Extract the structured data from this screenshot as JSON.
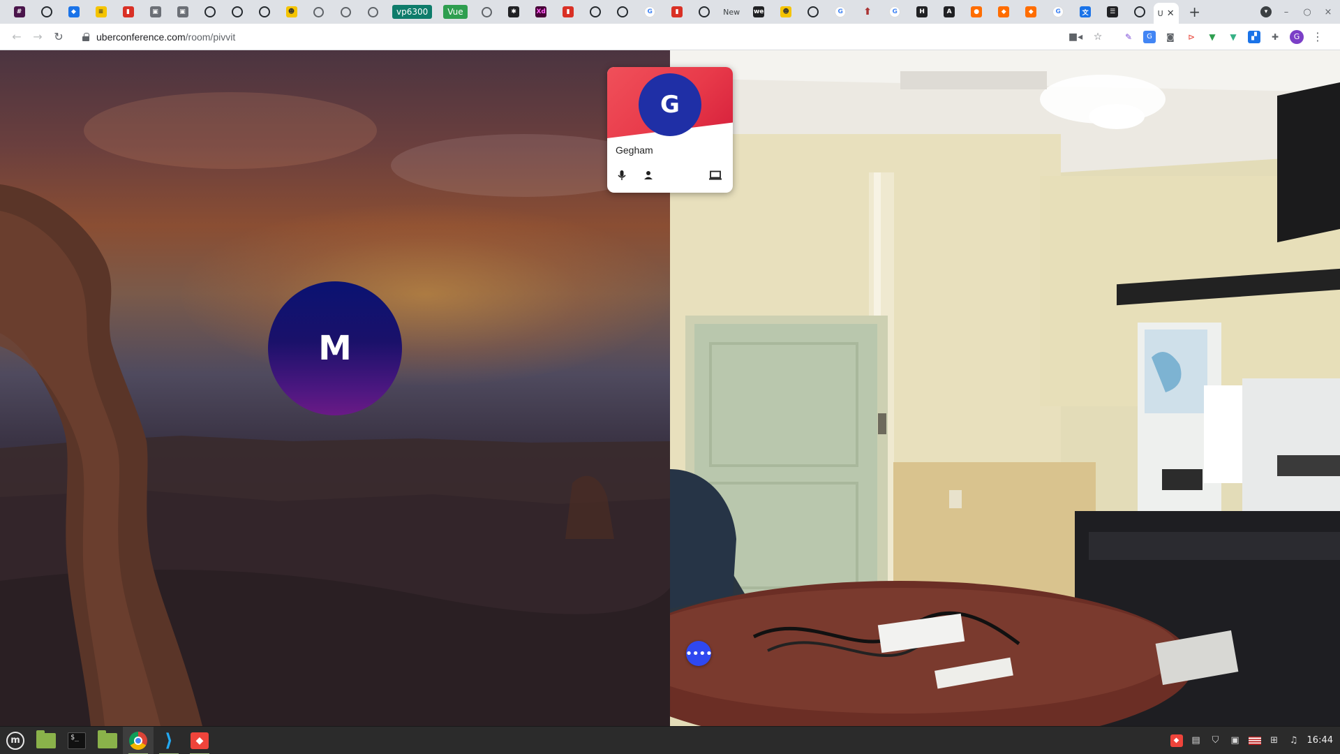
{
  "browser": {
    "tabs": [
      {
        "icon": "slack-icon",
        "kind": "slack",
        "glyph": "#"
      },
      {
        "icon": "github-icon",
        "kind": "github",
        "glyph": ""
      },
      {
        "icon": "jira-icon",
        "kind": "blue",
        "glyph": "◆"
      },
      {
        "icon": "stack-icon",
        "kind": "yellow",
        "glyph": "≡"
      },
      {
        "icon": "red-square-icon",
        "kind": "red",
        "glyph": "▮"
      },
      {
        "icon": "app-icon",
        "kind": "gray",
        "glyph": "▣"
      },
      {
        "icon": "app-icon",
        "kind": "gray",
        "glyph": "▣"
      },
      {
        "icon": "github-icon",
        "kind": "github",
        "glyph": ""
      },
      {
        "icon": "github-icon",
        "kind": "github",
        "glyph": ""
      },
      {
        "icon": "github-icon",
        "kind": "github",
        "glyph": ""
      },
      {
        "icon": "smiley-icon",
        "kind": "yellow",
        "glyph": "☻"
      },
      {
        "icon": "at-icon",
        "kind": "globe",
        "glyph": ""
      },
      {
        "icon": "globe-icon",
        "kind": "globe",
        "glyph": ""
      },
      {
        "icon": "globe-icon",
        "kind": "globe",
        "glyph": ""
      }
    ],
    "pill_tabs": [
      {
        "label": "vp6300",
        "color": "#0e7c6b"
      },
      {
        "label": "Vue",
        "color": "#2e9e4f"
      }
    ],
    "tabs_after": [
      {
        "icon": "globe-icon",
        "kind": "globe",
        "glyph": ""
      },
      {
        "icon": "puzzle-icon",
        "kind": "dark",
        "glyph": "✱"
      },
      {
        "icon": "adobe-xd-icon",
        "kind": "purple",
        "glyph": "Xd"
      },
      {
        "icon": "red-square-icon",
        "kind": "red",
        "glyph": "▮"
      },
      {
        "icon": "github-icon",
        "kind": "github",
        "glyph": ""
      },
      {
        "icon": "github-icon",
        "kind": "github",
        "glyph": ""
      },
      {
        "icon": "google-icon",
        "kind": "gg",
        "glyph": "G"
      },
      {
        "icon": "red-square-icon",
        "kind": "red",
        "glyph": "▮"
      },
      {
        "icon": "github-icon",
        "kind": "github",
        "glyph": ""
      }
    ],
    "text_tab": "New",
    "tabs_tail": [
      {
        "icon": "we-icon",
        "kind": "dark",
        "glyph": "we"
      },
      {
        "icon": "smiley-icon",
        "kind": "yellow",
        "glyph": "☻"
      },
      {
        "icon": "github-icon",
        "kind": "github",
        "glyph": ""
      },
      {
        "icon": "google-icon",
        "kind": "gg",
        "glyph": "G"
      },
      {
        "icon": "arrow-icon",
        "kind": "arrow",
        "glyph": "⬆"
      },
      {
        "icon": "google-icon",
        "kind": "gg",
        "glyph": "G"
      },
      {
        "icon": "html-icon",
        "kind": "dark",
        "glyph": "H"
      },
      {
        "icon": "figure-icon",
        "kind": "dark",
        "glyph": "A"
      },
      {
        "icon": "reddit-icon",
        "kind": "orange",
        "glyph": "●"
      },
      {
        "icon": "puzzle-piece-icon",
        "kind": "orange",
        "glyph": "◆"
      },
      {
        "icon": "puzzle-piece-icon",
        "kind": "orange",
        "glyph": "◆"
      },
      {
        "icon": "google-icon",
        "kind": "gg",
        "glyph": "G"
      },
      {
        "icon": "translate-icon",
        "kind": "blue",
        "glyph": "文"
      },
      {
        "icon": "doc-icon",
        "kind": "dark",
        "glyph": "☰"
      },
      {
        "icon": "github-icon",
        "kind": "github",
        "glyph": ""
      }
    ],
    "active_tab_label": "U",
    "active_tab_close": "✕",
    "new_tab": "+",
    "url_host": "uberconference.com",
    "url_path": "/room/pivvit",
    "profile_initial": "G"
  },
  "conference": {
    "left_participant_initial": "M",
    "card": {
      "avatar_initial": "G",
      "name": "Gegham"
    },
    "more_button": "••••"
  },
  "taskbar": {
    "menu_glyph": "m",
    "terminal_text": "$_",
    "vscode_glyph": "⟩",
    "clock": "16:44"
  },
  "colors": {
    "card_banner": "#e83a4a",
    "card_avatar": "#1f2fa6",
    "more_button": "#2f48f0",
    "avatar_m_top": "#0a1272",
    "avatar_m_bottom": "#6a1a86"
  }
}
